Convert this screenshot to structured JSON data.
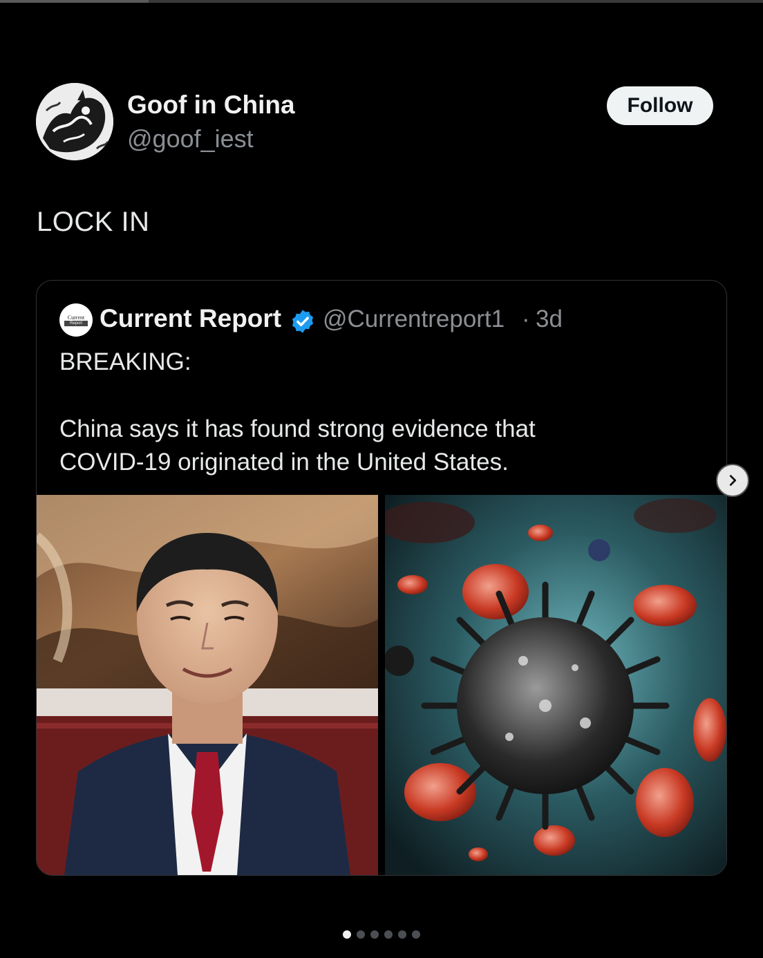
{
  "author": {
    "name": "Goof in China",
    "handle": "@goof_iest",
    "avatar_icon": "ink-dragon-avatar"
  },
  "follow_label": "Follow",
  "post_text": "LOCK IN",
  "quoted": {
    "avatar_text_top": "Current",
    "avatar_text_bottom": "Report",
    "name": "Current Report",
    "verified_icon": "verified-badge-icon",
    "handle": "@Currentreport1",
    "separator": "·",
    "time": "3d",
    "text_line_1": "BREAKING:",
    "text_line_2": "China says it has found strong evidence that",
    "text_line_3": "COVID-19 originated in the United States.",
    "images": [
      {
        "icon": "portrait-photo",
        "alt_semantic": "man in suit photo"
      },
      {
        "icon": "virus-illustration",
        "alt_semantic": "virus and blood cells illustration"
      }
    ]
  },
  "carousel": {
    "total": 6,
    "active_index": 0,
    "next_icon": "chevron-right-icon"
  },
  "colors": {
    "background": "#000000",
    "text": "#e7e9ea",
    "muted": "#8b8f94",
    "verified": "#1d9bf0",
    "border": "#2f3336"
  }
}
